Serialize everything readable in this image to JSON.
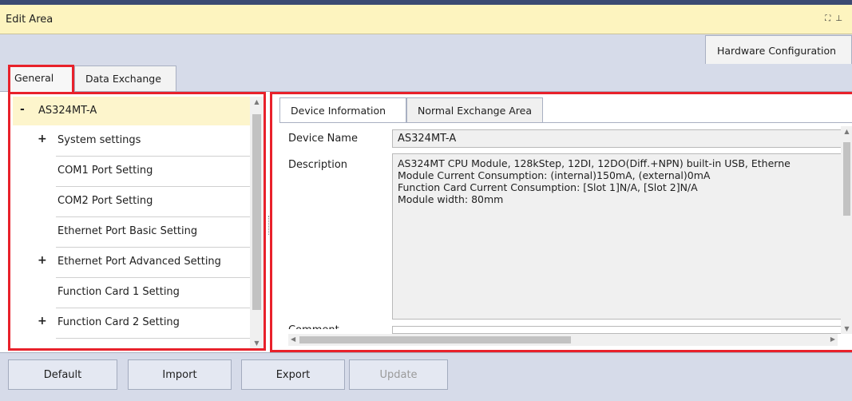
{
  "window": {
    "title": "Edit Area",
    "icons": [
      "maximize-icon",
      "pin-icon"
    ]
  },
  "top_tab": {
    "label": "Hardware Configuration"
  },
  "tabs": [
    {
      "label": "General",
      "selected": true
    },
    {
      "label": "Data Exchange",
      "selected": false
    }
  ],
  "tree": {
    "root": {
      "label": "AS324MT-A",
      "expander": "-"
    },
    "items": [
      {
        "label": "System settings",
        "expander": "+"
      },
      {
        "label": "COM1 Port Setting",
        "expander": ""
      },
      {
        "label": "COM2 Port Setting",
        "expander": ""
      },
      {
        "label": "Ethernet Port Basic Setting",
        "expander": ""
      },
      {
        "label": "Ethernet Port Advanced Setting",
        "expander": "+"
      },
      {
        "label": "Function Card 1 Setting",
        "expander": ""
      },
      {
        "label": "Function Card 2 Setting",
        "expander": "+"
      }
    ]
  },
  "detail_tabs": [
    {
      "label": "Device Information",
      "selected": true
    },
    {
      "label": "Normal Exchange Area",
      "selected": false
    }
  ],
  "device_info": {
    "device_name_label": "Device Name",
    "device_name_value": "AS324MT-A",
    "description_label": "Description",
    "description_lines": [
      "AS324MT CPU Module, 128kStep, 12DI, 12DO(Diff.+NPN) built-in USB, Etherne",
      "Module Current Consumption: (internal)150mA, (external)0mA",
      "Function Card Current Consumption: [Slot 1]N/A, [Slot 2]N/A",
      "Module width: 80mm"
    ],
    "comment_label": "Comment"
  },
  "buttons": {
    "default": "Default",
    "import": "Import",
    "export": "Export",
    "update": "Update"
  },
  "colors": {
    "title_bar": "#fdf4bf",
    "highlight_border": "#e8212b",
    "selected_tree_item": "#fdf5cc",
    "panel_bg": "#d6dbe9"
  }
}
